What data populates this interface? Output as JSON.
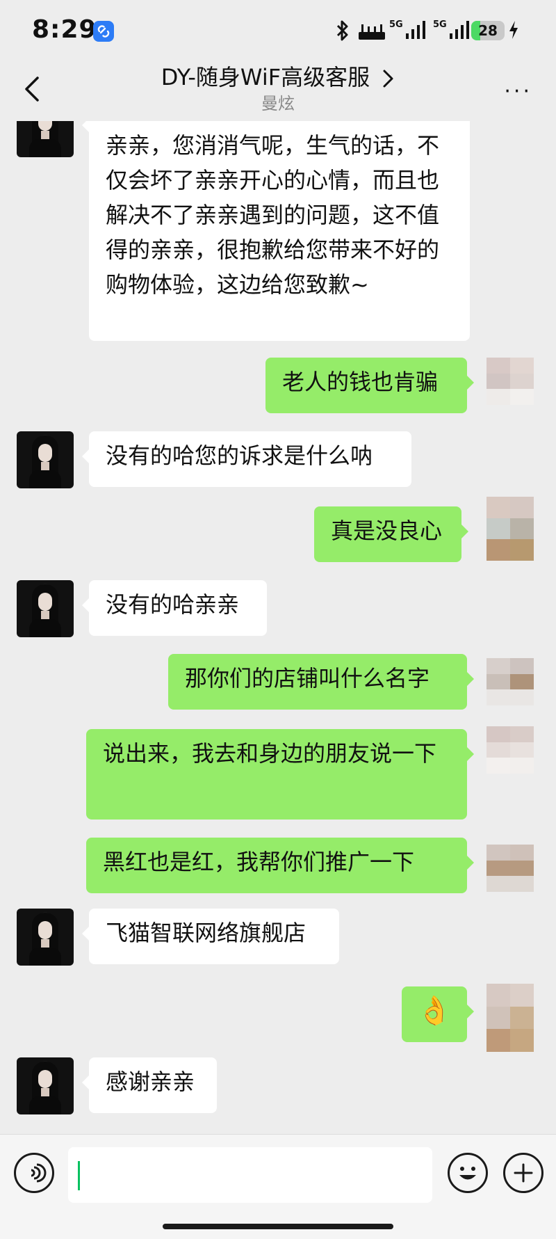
{
  "status_bar": {
    "time": "8:29",
    "network_1": "5G",
    "network_2": "5G",
    "battery": "28",
    "battery_level": 0.28
  },
  "header": {
    "title": "DY-随身WiF高级客服",
    "subtitle": "曼炫"
  },
  "messages": [
    {
      "from": "in",
      "text": "亲亲，您消消气呢，生气的话，不仅会坏了亲亲开心的心情，而且也解决不了亲亲遇到的问题，这不值得的亲亲，很抱歉给您带来不好的购物体验，这边给您致歉~"
    },
    {
      "from": "out",
      "text": "老人的钱也肯骗"
    },
    {
      "from": "in",
      "text": "没有的哈您的诉求是什么呐"
    },
    {
      "from": "out",
      "text": "真是没良心"
    },
    {
      "from": "in",
      "text": "没有的哈亲亲"
    },
    {
      "from": "out",
      "text": "那你们的店铺叫什么名字"
    },
    {
      "from": "out",
      "text": "说出来，我去和身边的朋友说一下"
    },
    {
      "from": "out",
      "text": "黑红也是红，我帮你们推广一下"
    },
    {
      "from": "in",
      "text": "飞猫智联网络旗舰店"
    },
    {
      "from": "out",
      "text": "👌"
    },
    {
      "from": "in",
      "text": "感谢亲亲"
    }
  ],
  "input": {
    "value": ""
  },
  "icons": {
    "voice": "voice-icon",
    "emoji": "emoji-icon",
    "plus": "plus-icon",
    "back": "back-arrow-icon",
    "more": "more-icon"
  },
  "colors": {
    "bubble_out": "#95ec69",
    "bubble_in": "#ffffff",
    "background": "#ededed",
    "caret": "#07c160"
  }
}
